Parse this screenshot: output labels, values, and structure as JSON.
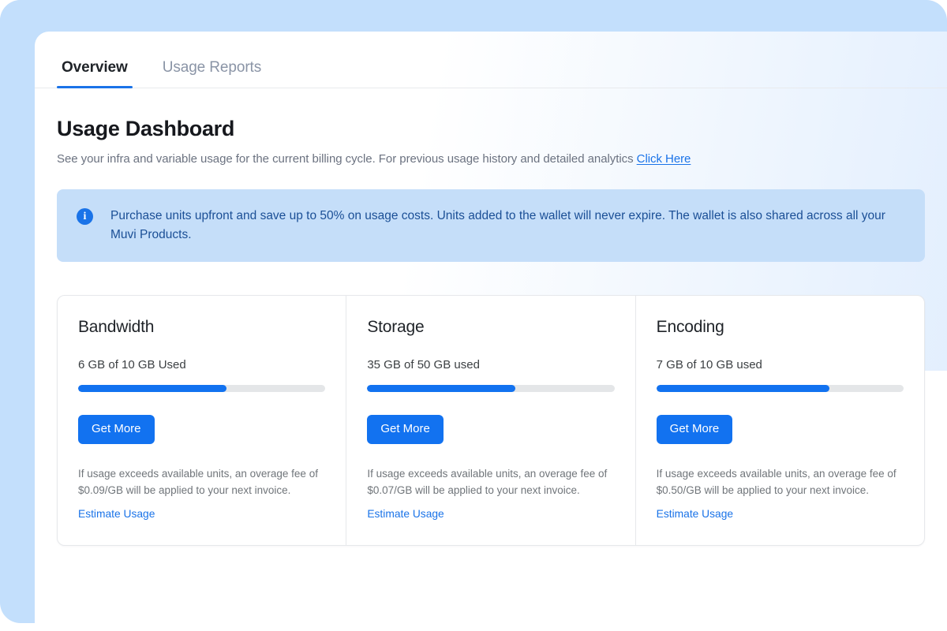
{
  "theme": {
    "accent": "#1272f0",
    "link": "#1a73e8",
    "banner_bg": "#c5def9",
    "banner_text": "#1b4f96",
    "backdrop": "#c3dffc",
    "track": "#e4e6e8"
  },
  "tabs": [
    {
      "label": "Overview",
      "active": true
    },
    {
      "label": "Usage Reports",
      "active": false
    }
  ],
  "header": {
    "title": "Usage Dashboard",
    "subtitle": "See your infra and variable usage for the current billing cycle. For previous usage history and detailed analytics",
    "link_label": "Click Here"
  },
  "banner": {
    "icon": "info-icon",
    "text": "Purchase units upfront and save up to 50% on usage costs. Units added to the wallet will never expire. The wallet is also shared across all your Muvi Products."
  },
  "cards": [
    {
      "title": "Bandwidth",
      "usage": "6 GB of 10 GB Used",
      "percent": 60,
      "button_label": "Get More",
      "note": "If usage exceeds available units, an overage fee of $0.09/GB will be applied to your next invoice.",
      "link_label": "Estimate Usage"
    },
    {
      "title": "Storage",
      "usage": "35 GB of 50 GB used",
      "percent": 60,
      "button_label": "Get More",
      "note": "If usage exceeds available units, an overage fee of $0.07/GB will be applied to your next invoice.",
      "link_label": "Estimate Usage"
    },
    {
      "title": "Encoding",
      "usage": "7 GB of 10 GB used",
      "percent": 70,
      "button_label": "Get More",
      "note": "If usage exceeds available units, an overage fee of $0.50/GB will be applied to your next invoice.",
      "link_label": "Estimate Usage"
    }
  ]
}
